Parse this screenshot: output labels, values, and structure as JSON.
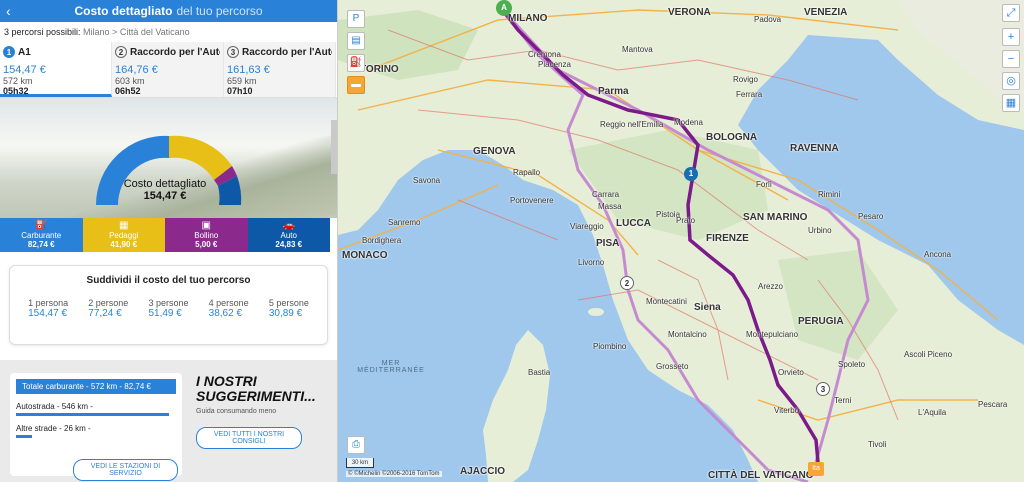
{
  "header": {
    "back_icon": "chevron-left-icon",
    "title_bold": "Costo dettagliato",
    "title_light": "del tuo percorso"
  },
  "summary": {
    "count": "3 percorsi possibili:",
    "route": "Milano > Città del Vaticano"
  },
  "routes": [
    {
      "num": "1",
      "name": "A1",
      "price": "154,47 €",
      "km": "572 km",
      "time": "05h32"
    },
    {
      "num": "2",
      "name": "Raccordo per l'Autostr...",
      "price": "164,76 €",
      "km": "603 km",
      "time": "06h52"
    },
    {
      "num": "3",
      "name": "Raccordo per l'Autostr...",
      "price": "161,63 €",
      "km": "659 km",
      "time": "07h10"
    }
  ],
  "gauge": {
    "label": "Costo dettagliato",
    "total": "154,47 €"
  },
  "costs": [
    {
      "label": "Carburante",
      "value": "82,74 €",
      "color": "#2a82d8",
      "icon": "fuel-icon"
    },
    {
      "label": "Pedaggi",
      "value": "41,90 €",
      "color": "#e8bf16",
      "icon": "toll-icon"
    },
    {
      "label": "Bollino",
      "value": "5,00 €",
      "color": "#8b2a8c",
      "icon": "vignette-icon"
    },
    {
      "label": "Auto",
      "value": "24,83 €",
      "color": "#0d59a8",
      "icon": "car-icon"
    }
  ],
  "split": {
    "title": "Suddividi il costo del tuo percorso",
    "items": [
      {
        "p": "1 persona",
        "v": "154,47 €"
      },
      {
        "p": "2 persone",
        "v": "77,24 €"
      },
      {
        "p": "3 persone",
        "v": "51,49 €"
      },
      {
        "p": "4 persone",
        "v": "38,62 €"
      },
      {
        "p": "5 persone",
        "v": "30,89 €"
      }
    ]
  },
  "fuel": {
    "bar": "Totale carburante - 572 km - 82,74 €",
    "highway": "Autostrada - 546 km -",
    "highway_fraction": 0.955,
    "other": "Altre strade - 26 km -",
    "other_fraction": 0.045,
    "stations_btn": "VEDI LE STAZIONI DI SERVIZIO"
  },
  "suggestions": {
    "title": "I NOSTRI SUGGERIMENTI...",
    "sub": "Guida consumando meno",
    "btn": "VEDI TUTTI I NOSTRI CONSIGLI"
  },
  "map": {
    "cities": [
      "MILANO",
      "VERONA",
      "Padova",
      "VENEZIA",
      "TORINO",
      "Piacenza",
      "Cremona",
      "Mantova",
      "Rovigo",
      "Ferrara",
      "Parma",
      "Reggio nell'Emilia",
      "Modena",
      "BOLOGNA",
      "RAVENNA",
      "GENOVA",
      "Rapallo",
      "Savona",
      "Forlì",
      "Rimini",
      "Portovenere",
      "Carrara",
      "Massa",
      "SAN MARINO",
      "Pesaro",
      "Viareggio",
      "LUCCA",
      "Pistoia",
      "Prato",
      "FIRENZE",
      "Urbino",
      "PISA",
      "Livorno",
      "Ancona",
      "MONACO",
      "Arezzo",
      "Siena",
      "PERUGIA",
      "Piombino",
      "Grosseto",
      "Montepulciano",
      "Bastia",
      "Spoleto",
      "Terni",
      "Ascoli Piceno",
      "Orvieto",
      "L'Aquila",
      "Viterbo",
      "Pescara",
      "CITTÀ DEL VATICANO",
      "AJACCIO",
      "Bordighera",
      "Sanremo",
      "Montecatini",
      "Montalcino",
      "Tivoli"
    ],
    "sea_label": "MER MÉDITERRANÉE",
    "scale": "30 km",
    "copyright": "© ©Michelin ©2006-2016 TomTom",
    "start": "A",
    "end": "Ita",
    "route_markers": [
      "1",
      "2",
      "3"
    ]
  }
}
